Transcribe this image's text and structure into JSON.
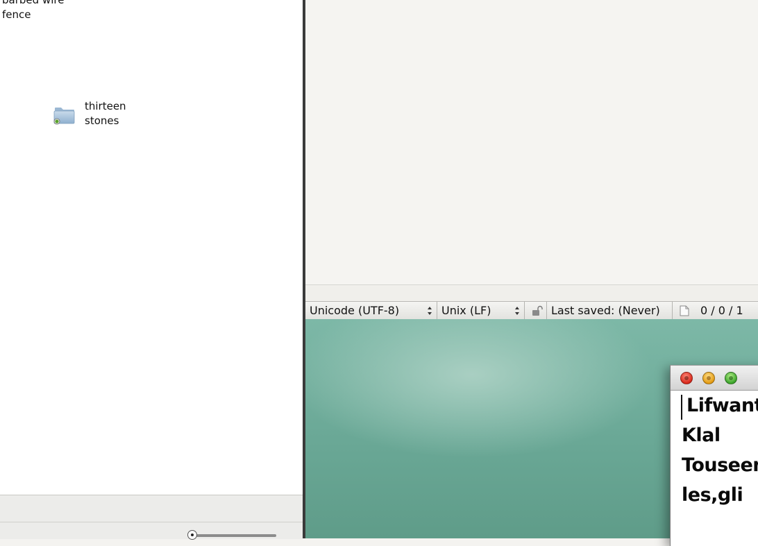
{
  "finder": {
    "items": [
      {
        "label": "barbed wire\nfence"
      },
      {
        "label": "thirteen\nstones",
        "icon": "folder-icon"
      }
    ]
  },
  "editor": {
    "statusbar": {
      "encoding": "Unicode (UTF-8)",
      "line_endings": "Unix (LF)",
      "last_saved": "Last saved: (Never)",
      "counts": "0 / 0 / 1"
    }
  },
  "note": {
    "lines": [
      "Lifwant",
      "Klal",
      "Touseen",
      "les,gli"
    ]
  },
  "colors": {
    "desktop": "#6aa896",
    "close": "#d8281b",
    "minimize": "#e39a12",
    "zoom": "#3aa42a"
  }
}
